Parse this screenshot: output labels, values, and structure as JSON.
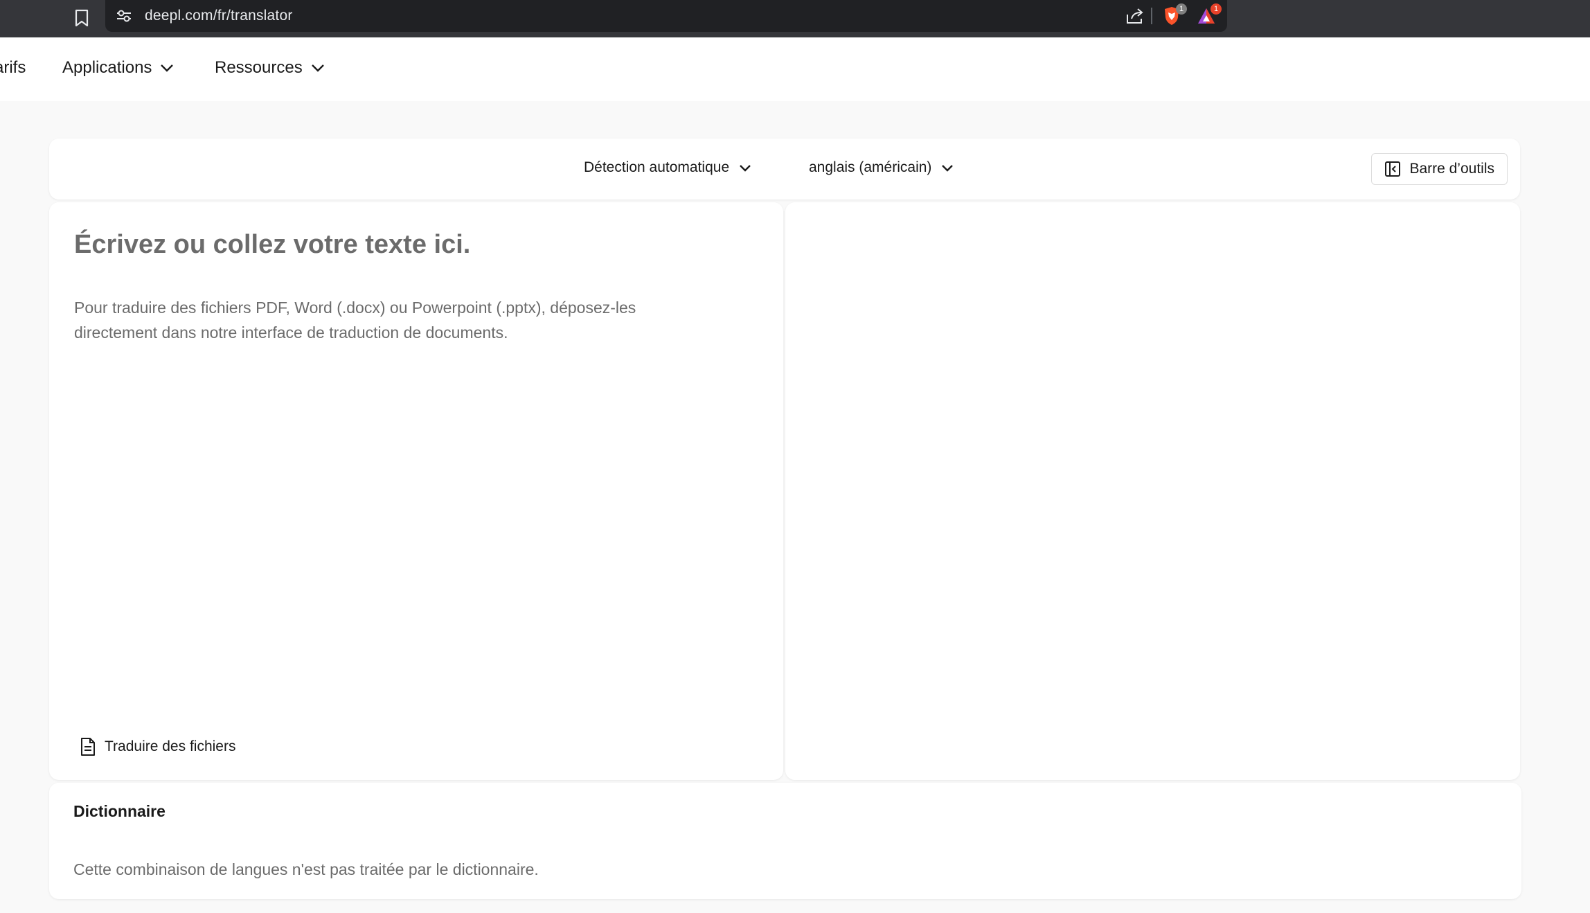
{
  "browser": {
    "url": "deepl.com/fr/translator",
    "extensions": [
      {
        "name": "brave-shields",
        "badge": "1",
        "badge_color": "#808080"
      },
      {
        "name": "brave-rewards",
        "badge": "1",
        "badge_color": "#e8422a"
      }
    ]
  },
  "nav": {
    "items": [
      {
        "label": "Tarifs"
      },
      {
        "label": "Applications"
      },
      {
        "label": "Ressources"
      }
    ]
  },
  "languages": {
    "source": "Détection automatique",
    "target": "anglais (américain)",
    "toolbar_label": "Barre d’outils"
  },
  "source_panel": {
    "placeholder": "Écrivez ou collez votre texte ici.",
    "hint": "Pour traduire des fichiers PDF, Word (.docx) ou Powerpoint (.pptx), déposez-les directement dans notre interface de traduction de documents.",
    "translate_files_label": "Traduire des fichiers"
  },
  "dictionary": {
    "title": "Dictionnaire",
    "message": "Cette combinaison de langues n'est pas traitée par le dictionnaire."
  },
  "colors": {
    "page_bg": "#f9f9f9",
    "browser_bar": "#35363a",
    "muted_text": "#6b6b6b"
  }
}
